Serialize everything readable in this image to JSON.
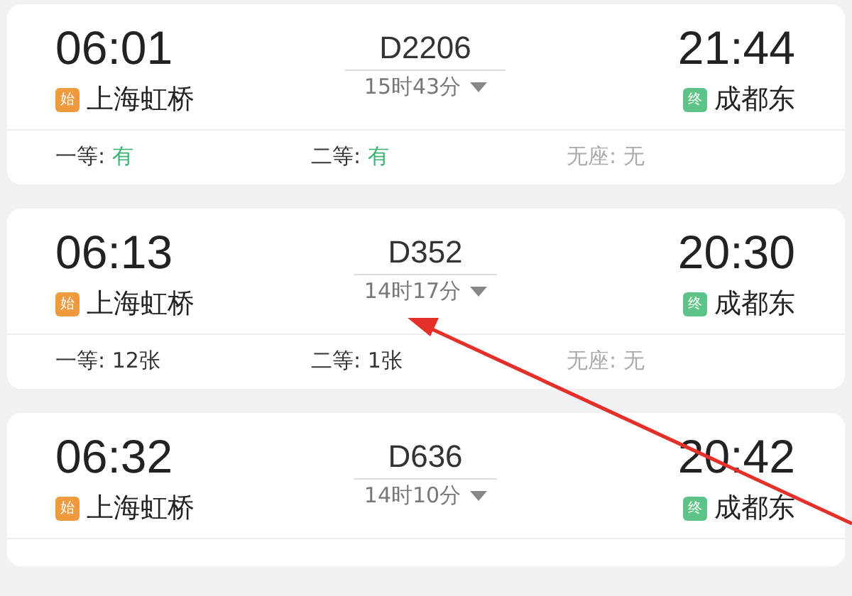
{
  "trains": [
    {
      "depart_time": "06:01",
      "origin_badge": "始",
      "origin": "上海虹桥",
      "number": "D2206",
      "duration": "15时43分",
      "arrive_time": "21:44",
      "dest_badge": "终",
      "destination": "成都东",
      "seats": [
        {
          "label": "一等:",
          "value": "有",
          "kind": "yes"
        },
        {
          "label": "二等:",
          "value": "有",
          "kind": "yes"
        },
        {
          "label": "无座:",
          "value": "无",
          "kind": "none"
        }
      ]
    },
    {
      "depart_time": "06:13",
      "origin_badge": "始",
      "origin": "上海虹桥",
      "number": "D352",
      "duration": "14时17分",
      "arrive_time": "20:30",
      "dest_badge": "终",
      "destination": "成都东",
      "seats": [
        {
          "label": "一等:",
          "value": "12张",
          "kind": "count"
        },
        {
          "label": "二等:",
          "value": "1张",
          "kind": "count"
        },
        {
          "label": "无座:",
          "value": "无",
          "kind": "none"
        }
      ]
    },
    {
      "depart_time": "06:32",
      "origin_badge": "始",
      "origin": "上海虹桥",
      "number": "D636",
      "duration": "14时10分",
      "arrive_time": "20:42",
      "dest_badge": "终",
      "destination": "成都东"
    }
  ]
}
